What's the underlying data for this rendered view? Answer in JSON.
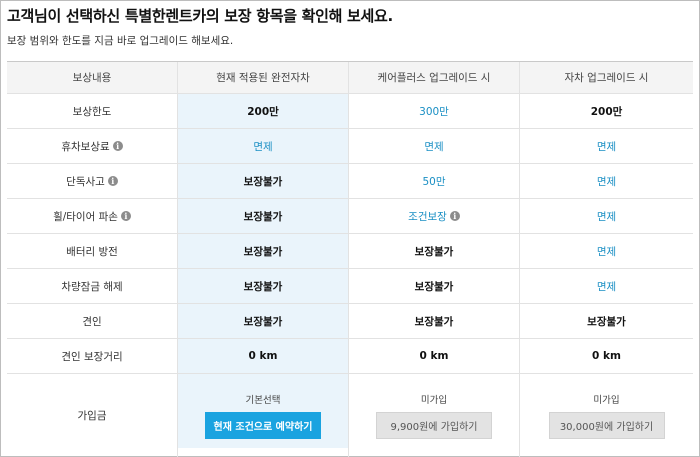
{
  "title": "고객님이 선택하신 특별한렌트카의 보장 항목을 확인해 보세요.",
  "subtitle": "보장 범위와 한도를 지금 바로 업그레이드 해보세요.",
  "table": {
    "headers": [
      "보상내용",
      "현재 적용된 완전자차",
      "케어플러스 업그레이드 시",
      "자차 업그레이드 시"
    ],
    "rows": [
      {
        "label": "보상한도",
        "info": false,
        "cells": [
          "200만",
          "300만",
          "200만"
        ]
      },
      {
        "label": "휴차보상료",
        "info": true,
        "cells": [
          "면제",
          "면제",
          "면제"
        ]
      },
      {
        "label": "단독사고",
        "info": true,
        "cells": [
          "보장불가",
          "50만",
          "면제"
        ]
      },
      {
        "label": "휠/타이어 파손",
        "info": true,
        "cells": [
          "보장불가",
          "조건보장",
          "면제"
        ]
      },
      {
        "label": "배터리 방전",
        "info": false,
        "cells": [
          "보장불가",
          "보장불가",
          "면제"
        ]
      },
      {
        "label": "차량잠금 해제",
        "info": false,
        "cells": [
          "보장불가",
          "보장불가",
          "면제"
        ]
      },
      {
        "label": "견인",
        "info": false,
        "cells": [
          "보장불가",
          "보장불가",
          "보장불가"
        ]
      },
      {
        "label": "견인 보장거리",
        "info": false,
        "cells": [
          "0 km",
          "0 km",
          "0 km"
        ]
      }
    ],
    "subscription": {
      "label": "가입금",
      "current": {
        "status": "기본선택",
        "button": "현재 조건으로 예약하기"
      },
      "careplus": {
        "status": "미가입",
        "button": "9,900원에 가입하기"
      },
      "selfcar": {
        "status": "미가입",
        "button": "30,000원에 가입하기"
      }
    }
  },
  "info_glyph": "i",
  "colors": {
    "accent": "#1aa3e0",
    "link_blue": "#1a8fc4",
    "highlight_column": "#eaf4fb",
    "header_bg": "#f4f4f4"
  }
}
